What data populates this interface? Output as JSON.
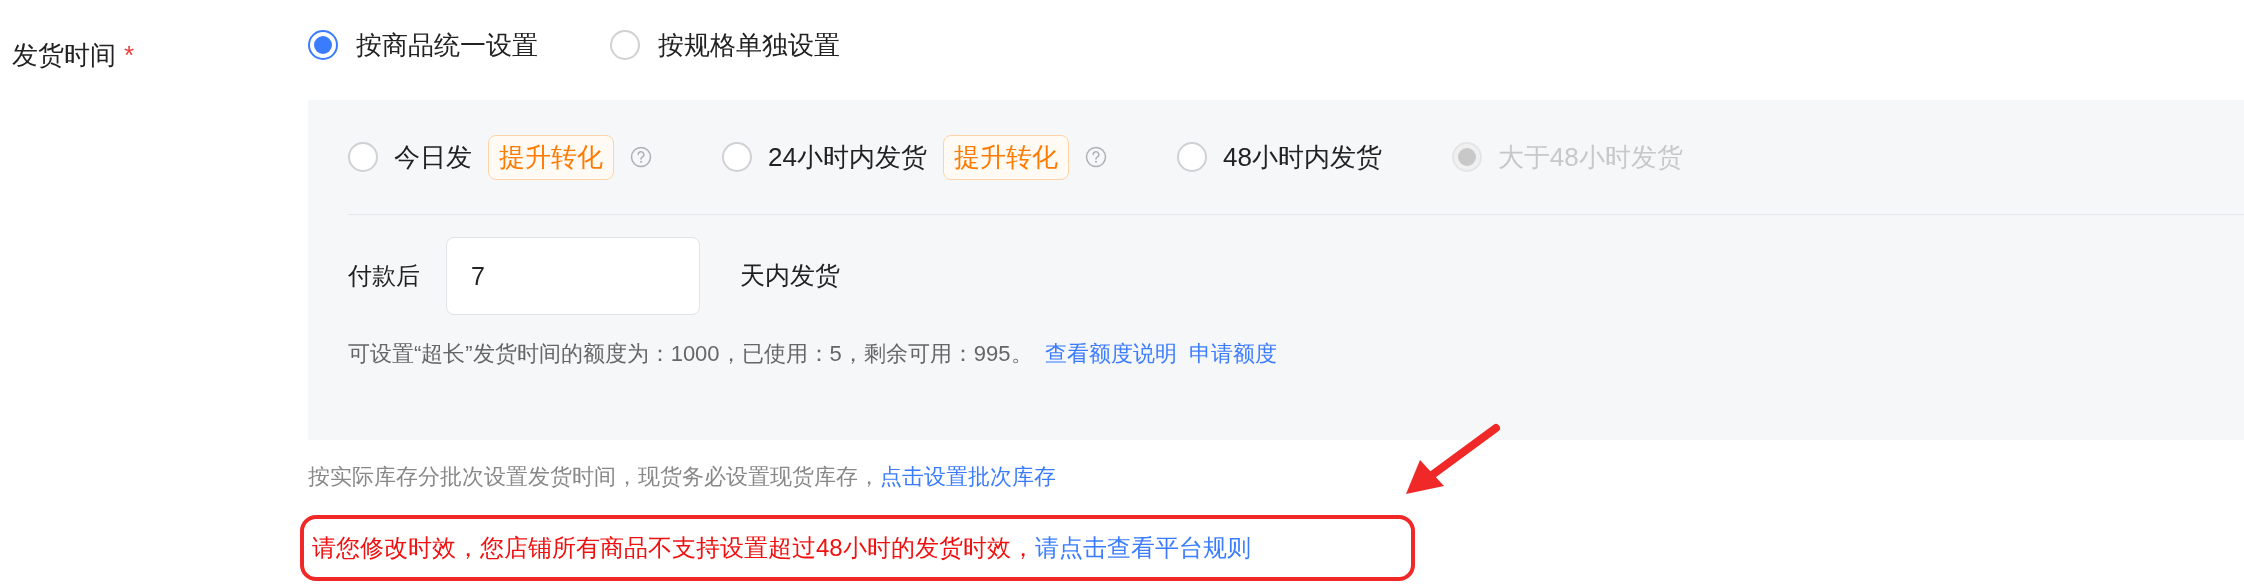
{
  "field": {
    "label": "发货时间",
    "required_mark": "*"
  },
  "mode_options": [
    {
      "label": "按商品统一设置",
      "selected": true
    },
    {
      "label": "按规格单独设置",
      "selected": false
    }
  ],
  "time_options": [
    {
      "label": "今日发",
      "badge": "提升转化",
      "help": true,
      "selected": false,
      "disabled": false
    },
    {
      "label": "24小时内发货",
      "badge": "提升转化",
      "help": true,
      "selected": false,
      "disabled": false
    },
    {
      "label": "48小时内发货",
      "help": false,
      "selected": false,
      "disabled": false
    },
    {
      "label": "大于48小时发货",
      "help": false,
      "selected": true,
      "disabled": true
    }
  ],
  "days": {
    "prefix": "付款后",
    "value": "7",
    "suffix": "天内发货"
  },
  "quota": {
    "text": "可设置“超长”发货时间的额度为：1000，已使用：5，剩余可用：995。",
    "links": [
      "查看额度说明",
      "申请额度"
    ]
  },
  "batch_hint": {
    "text": "按实际库存分批次设置发货时间，现货务必设置现货库存，",
    "link": "点击设置批次库存"
  },
  "error": {
    "text": "请您修改时效，您店铺所有商品不支持设置超过48小时的发货时效，",
    "link": "请点击查看平台规则"
  }
}
